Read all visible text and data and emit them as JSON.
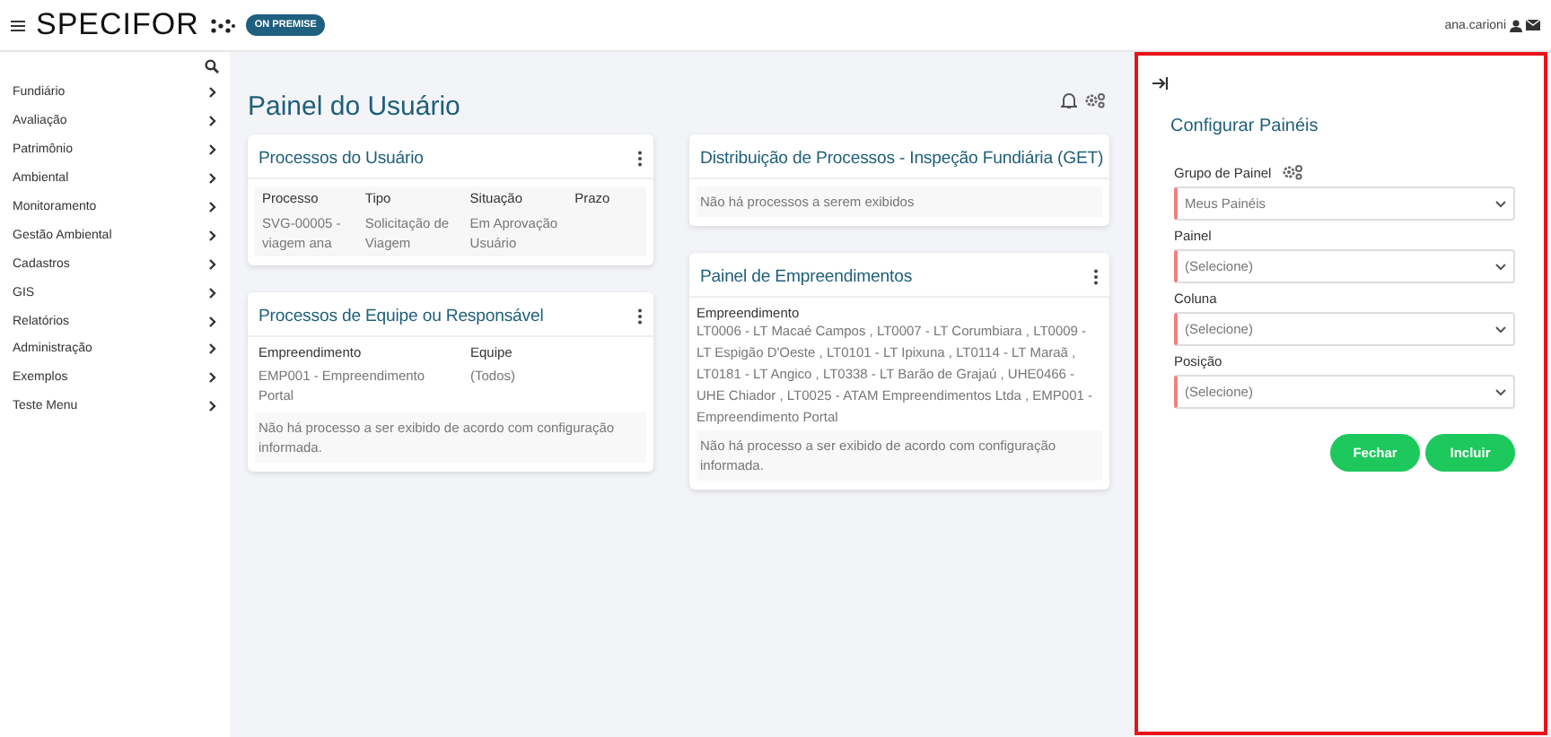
{
  "header": {
    "logo": "SPECIFOR",
    "badge": "ON PREMISE",
    "user": "ana.carioni"
  },
  "sidebar": {
    "items": [
      {
        "label": "Fundiário"
      },
      {
        "label": "Avaliação"
      },
      {
        "label": "Patrimônio"
      },
      {
        "label": "Ambiental"
      },
      {
        "label": "Monitoramento"
      },
      {
        "label": "Gestão Ambiental"
      },
      {
        "label": "Cadastros"
      },
      {
        "label": "GIS"
      },
      {
        "label": "Relatórios"
      },
      {
        "label": "Administração"
      },
      {
        "label": "Exemplos"
      },
      {
        "label": "Teste Menu"
      }
    ]
  },
  "main": {
    "title": "Painel do Usuário",
    "columns": [
      [
        {
          "kind": "table",
          "title": "Processos do Usuário",
          "columns": [
            "Processo",
            "Tipo",
            "Situação",
            "Prazo"
          ],
          "rows": [
            [
              "SVG-00005 - viagem ana",
              "Solicitação de Viagem",
              "Em Aprovação Usuário",
              ""
            ]
          ]
        },
        {
          "kind": "fields",
          "title": "Processos de Equipe ou Responsável",
          "fields": [
            {
              "label": "Empreendimento",
              "value": "EMP001 - Empreendimento Portal"
            },
            {
              "label": "Equipe",
              "value": "(Todos)"
            }
          ],
          "message": "Não há processo a ser exibido de acordo com configuração informada."
        }
      ],
      [
        {
          "kind": "message",
          "title": "Distribuição de Processos - Inspeção Fundiária (GET)",
          "message": "Não há processos a serem exibidos"
        },
        {
          "kind": "list",
          "title": "Painel de Empreendimentos",
          "label": "Empreendimento",
          "value": "LT0006 - LT Macaé Campos , LT0007 - LT Corumbiara , LT0009 - LT Espigão D'Oeste , LT0101 - LT Ipixuna , LT0114 - LT Maraã , LT0181 - LT Angico , LT0338 - LT Barão de Grajaú , UHE0466 - UHE Chiador , LT0025 - ATAM Empreendimentos Ltda , EMP001 - Empreendimento Portal",
          "message": "Não há processo a ser exibido de acordo com configuração informada."
        }
      ]
    ]
  },
  "config": {
    "title": "Configurar Painéis",
    "fields": [
      {
        "label": "Grupo de Painel",
        "value": "Meus Painéis"
      },
      {
        "label": "Painel",
        "value": "(Selecione)"
      },
      {
        "label": "Coluna",
        "value": "(Selecione)"
      },
      {
        "label": "Posição",
        "value": "(Selecione)"
      }
    ],
    "buttons": [
      "Fechar",
      "Incluir"
    ]
  }
}
